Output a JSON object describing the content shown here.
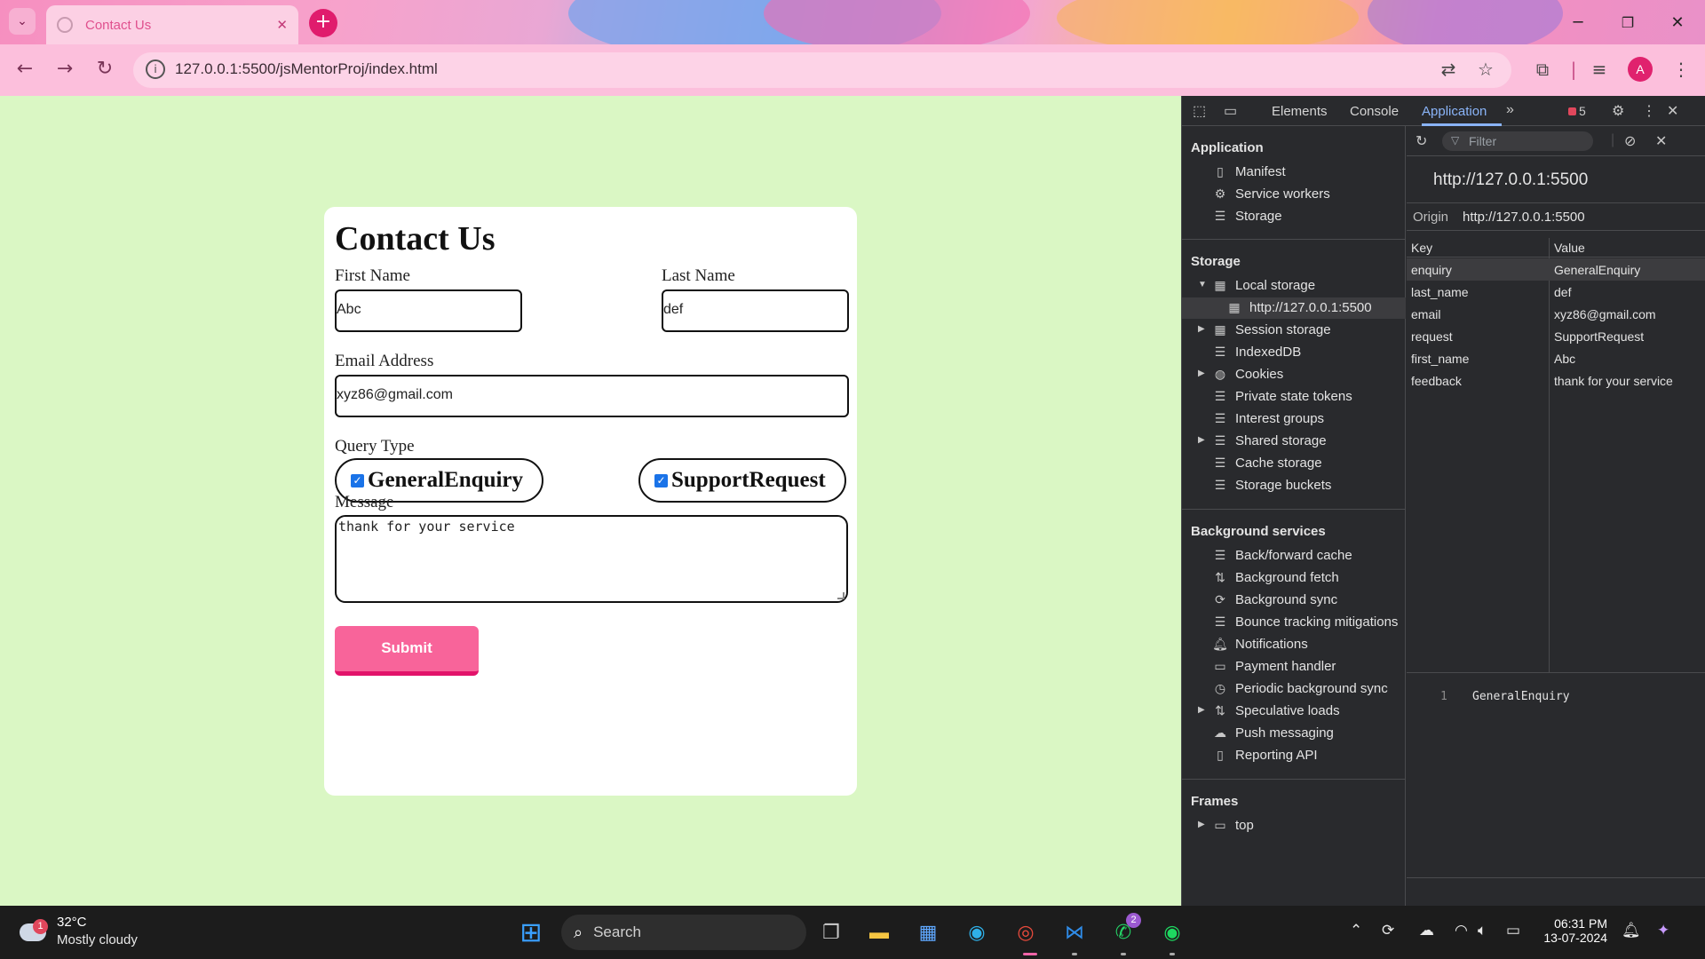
{
  "browser": {
    "tab_title": "Contact Us",
    "tab_close": "✕",
    "new_tab": "+",
    "url": "127.0.0.1:5500/jsMentorProj/index.html",
    "window_minimize": "─",
    "window_restore": "❐",
    "window_close": "✕",
    "profile_initial": "A"
  },
  "page": {
    "title": "Contact Us",
    "first_name_label": "First Name",
    "first_name_value": "Abc",
    "last_name_label": "Last Name",
    "last_name_value": "def",
    "email_label": "Email Address",
    "email_value": "xyz86@gmail.com",
    "query_type_label": "Query Type",
    "query_options": [
      {
        "label": "GeneralEnquiry",
        "checked": true
      },
      {
        "label": "SupportRequest",
        "checked": true
      }
    ],
    "message_label": "Message",
    "message_value": "thank for your service",
    "submit_label": "Submit",
    "accent_color": "#f8649a"
  },
  "devtools": {
    "tabs": [
      "Elements",
      "Console",
      "Application"
    ],
    "active_tab": "Application",
    "issues_count": "5",
    "application_section": "Application",
    "application_items": [
      "Manifest",
      "Service workers",
      "Storage"
    ],
    "storage_section": "Storage",
    "storage_items": [
      "Local storage",
      "http://127.0.0.1:5500",
      "Session storage",
      "IndexedDB",
      "Cookies",
      "Private state tokens",
      "Interest groups",
      "Shared storage",
      "Cache storage",
      "Storage buckets"
    ],
    "background_section": "Background services",
    "background_items": [
      "Back/forward cache",
      "Background fetch",
      "Background sync",
      "Bounce tracking mitigations",
      "Notifications",
      "Payment handler",
      "Periodic background sync",
      "Speculative loads",
      "Push messaging",
      "Reporting API"
    ],
    "frames_section": "Frames",
    "frames_items": [
      "top"
    ],
    "filter_placeholder": "Filter",
    "origin_heading": "http://127.0.0.1:5500",
    "origin_label": "Origin",
    "origin_value": "http://127.0.0.1:5500",
    "table_headers": {
      "key": "Key",
      "value": "Value"
    },
    "rows": [
      {
        "key": "enquiry",
        "value": "GeneralEnquiry"
      },
      {
        "key": "last_name",
        "value": "def"
      },
      {
        "key": "email",
        "value": "xyz86@gmail.com"
      },
      {
        "key": "request",
        "value": "SupportRequest"
      },
      {
        "key": "first_name",
        "value": "Abc"
      },
      {
        "key": "feedback",
        "value": "thank for your service"
      }
    ],
    "preview_line": "1",
    "preview_value": "GeneralEnquiry"
  },
  "taskbar": {
    "weather_badge": "1",
    "temperature": "32°C",
    "condition": "Mostly cloudy",
    "search_label": "Search",
    "whatsapp_badge": "2",
    "time": "06:31 PM",
    "date": "13-07-2024"
  }
}
